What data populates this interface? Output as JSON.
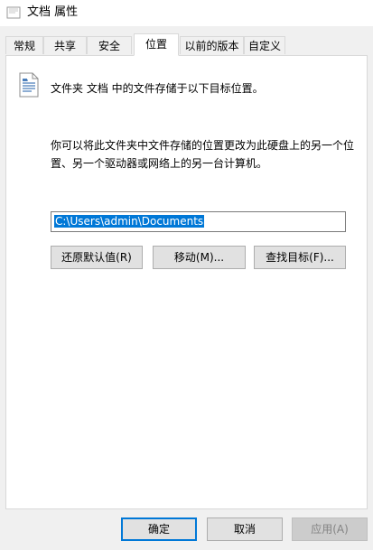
{
  "window": {
    "title": "文档 属性",
    "folder_icon": "folder-icon"
  },
  "tabs": [
    {
      "label": "常规"
    },
    {
      "label": "共享"
    },
    {
      "label": "安全"
    },
    {
      "label": "位置",
      "active": true
    },
    {
      "label": "以前的版本"
    },
    {
      "label": "自定义"
    }
  ],
  "location": {
    "header": "文件夹 文档 中的文件存储于以下目标位置。",
    "description": "你可以将此文件夹中文件存储的位置更改为此硬盘上的另一个位置、另一个驱动器或网络上的另一台计算机。",
    "path_value": "C:\\Users\\admin\\Documents",
    "icon": "document-icon",
    "buttons": {
      "restore": "还原默认值(R)",
      "move": "移动(M)...",
      "find_target": "查找目标(F)..."
    }
  },
  "footer": {
    "ok": "确定",
    "cancel": "取消",
    "apply": "应用(A)"
  }
}
